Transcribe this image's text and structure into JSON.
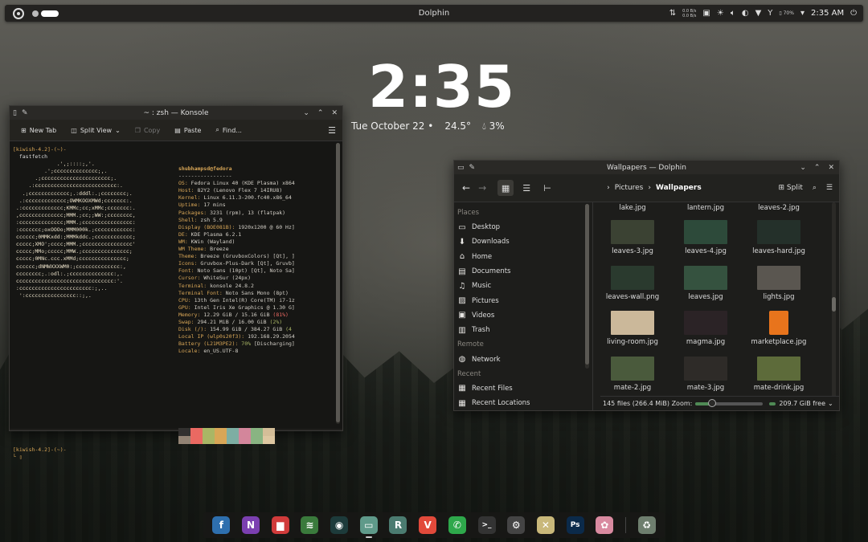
{
  "panel": {
    "title": "Dolphin",
    "net_up": "0.0 B/s",
    "net_down": "0.0 B/s",
    "battery": "70%",
    "clock": "2:35 AM"
  },
  "clock_widget": {
    "time": "2:35",
    "date": "Tue October 22 •",
    "temperature": "24.5°",
    "humidity": "3%"
  },
  "konsole": {
    "title": "~ : zsh — Konsole",
    "toolbar": {
      "new_tab": "New Tab",
      "split_view": "Split View",
      "copy": "Copy",
      "paste": "Paste",
      "find": "Find..."
    },
    "prompt1": "[kiwish-4.2]-(~)-",
    "command": "  fastfetch",
    "logo": [
      "              .',;::::;,'.",
      "          .';cccccccccccccc;,.",
      "       .;cccccccccccccccccccccc;.",
      "     .:cccccccccccccccccccccccccc:.",
      "   .;ccccccccccccc;.:dddl:.;cccccccc;.",
      "  .:ccccccccccccc;OWMKOOXMWd;ccccccc:.",
      " .:ccccccccccccc;KMMc;cc;xMMc;ccccccc:.",
      " ,cccccccccccccc;MMM.;cc;;WW:;cccccccc,",
      " :cccccccccccccc;MMM.;cccccccccccccccc:",
      " :ccccccc;oxOOOo;MMM000k.;cccccccccccc:",
      " cccccc;0MMKxdd:;MMMkddc.;cccccccccccc;",
      " ccccc;XMO';cccc;MMM.;cccccccccccccccc'",
      " ccccc;MMo;ccccc;MMW.;ccccccccccccccc;",
      " ccccc;0MNc.ccc.xMMd;ccccccccccccccc;",
      " cccccc;dNMWXXXWM0:;cccccccccccccc:,",
      " cccccccc;.:odl:.;cccccccccccccc:,.",
      " ccccccccccccccccccccccccccccccc:'.",
      " :ccccccccccccccccccccccc:;,..",
      "  ':cccccccccccccccc::;,."
    ],
    "info_header": "shubhampsd@fedora",
    "info_rule": "-----------------",
    "info": [
      {
        "k": "OS",
        "v": "Fedora Linux 40 (KDE Plasma) x864"
      },
      {
        "k": "Host",
        "v": "82Y2 (Lenovo Flex 7 14IRU8)"
      },
      {
        "k": "Kernel",
        "v": "Linux 6.11.3-200.fc40.x86_64"
      },
      {
        "k": "Uptime",
        "v": "17 mins"
      },
      {
        "k": "Packages",
        "v": "3231 (rpm), 13 (flatpak)"
      },
      {
        "k": "Shell",
        "v": "zsh 5.9"
      },
      {
        "k": "Display (BOE081B)",
        "v": "1920x1200 @ 60 Hz]"
      },
      {
        "k": "DE",
        "v": "KDE Plasma 6.2.1"
      },
      {
        "k": "WM",
        "v": "KWin (Wayland)"
      },
      {
        "k": "WM Theme",
        "v": "Breeze"
      },
      {
        "k": "Theme",
        "v": "Breeze (GruvboxColors) [Qt], ]"
      },
      {
        "k": "Icons",
        "v": "Gruvbox-Plus-Dark [Qt], Gruvb]"
      },
      {
        "k": "Font",
        "v": "Noto Sans (10pt) [Qt], Noto Sa]"
      },
      {
        "k": "Cursor",
        "v": "WhiteSur (24px)"
      },
      {
        "k": "Terminal",
        "v": "konsole 24.8.2"
      },
      {
        "k": "Terminal Font",
        "v": "Noto Sans Mono (8pt)"
      },
      {
        "k": "CPU",
        "v": "13th Gen Intel(R) Core(TM) i7-1z"
      },
      {
        "k": "GPU",
        "v": "Intel Iris Xe Graphics @ 1.30 G]"
      },
      {
        "k": "Memory",
        "v": "12.29 GiB / 15.16 GiB ",
        "extra": "(81%)",
        "extra_class": "warn"
      },
      {
        "k": "Swap",
        "v": "294.21 MiB / 16.00 GiB ",
        "extra": "(2%)",
        "extra_class": "ok"
      },
      {
        "k": "Disk (/)",
        "v": "154.99 GiB / 384.27 GiB ",
        "extra": "(4",
        "extra_class": "ok"
      },
      {
        "k": "Local IP (wlp0s20f3)",
        "v": "192.168.29.2054"
      },
      {
        "k": "Battery (L21M3PE2)",
        "v": "",
        "extra": "70%",
        "extra_class": "ok",
        "tail": " [Discharging]"
      },
      {
        "k": "Locale",
        "v": "en_US.UTF-8"
      }
    ],
    "palette": [
      "#32302f",
      "#ea6962",
      "#a9b665",
      "#d8a657",
      "#7daea3",
      "#d3869b",
      "#89b482",
      "#d4be98",
      "#928374",
      "#ea6962",
      "#a9b665",
      "#d8a657",
      "#7daea3",
      "#d3869b",
      "#89b482",
      "#ddc7a1"
    ],
    "prompt2": "[kiwish-4.2]-(~)-"
  },
  "dolphin": {
    "title": "Wallpapers — Dolphin",
    "breadcrumb_parent": "Pictures",
    "breadcrumb_current": "Wallpapers",
    "split_label": "Split",
    "places_header": "Places",
    "places": [
      {
        "label": "Desktop",
        "icon": "desktop-icon",
        "glyph": "▭"
      },
      {
        "label": "Downloads",
        "icon": "download-icon",
        "glyph": "⬇"
      },
      {
        "label": "Home",
        "icon": "home-icon",
        "glyph": "⌂"
      },
      {
        "label": "Documents",
        "icon": "document-icon",
        "glyph": "▤"
      },
      {
        "label": "Music",
        "icon": "music-icon",
        "glyph": "♫"
      },
      {
        "label": "Pictures",
        "icon": "picture-icon",
        "glyph": "▨"
      },
      {
        "label": "Videos",
        "icon": "video-icon",
        "glyph": "▣"
      },
      {
        "label": "Trash",
        "icon": "trash-icon",
        "glyph": "▥"
      }
    ],
    "remote_header": "Remote",
    "remote": [
      {
        "label": "Network",
        "icon": "network-icon",
        "glyph": "◍"
      }
    ],
    "recent_header": "Recent",
    "recent": [
      {
        "label": "Recent Files",
        "icon": "recent-files-icon",
        "glyph": "▦"
      },
      {
        "label": "Recent Locations",
        "icon": "recent-locations-icon",
        "glyph": "▦"
      }
    ],
    "files": [
      {
        "name": "lake.jpg",
        "thumb": ""
      },
      {
        "name": "lantern.jpg",
        "thumb": ""
      },
      {
        "name": "leaves-2.jpg",
        "thumb": ""
      },
      {
        "name": "leaves-3.jpg",
        "thumb": "#3b4233"
      },
      {
        "name": "leaves-4.jpg",
        "thumb": "#2d4a3a"
      },
      {
        "name": "leaves-hard.jpg",
        "thumb": "#24302a"
      },
      {
        "name": "leaves-wall.png",
        "thumb": "#2a3a2e"
      },
      {
        "name": "leaves.jpg",
        "thumb": "#35523f"
      },
      {
        "name": "lights.jpg",
        "thumb": "#5a5650"
      },
      {
        "name": "living-room.jpg",
        "thumb": "#cbb89a"
      },
      {
        "name": "magma.jpg",
        "thumb": "#2b2326"
      },
      {
        "name": "marketplace.jpg",
        "thumb": "#e8741c"
      },
      {
        "name": "mate-2.jpg",
        "thumb": "#4a5a3c"
      },
      {
        "name": "mate-3.jpg",
        "thumb": "#2e2b28"
      },
      {
        "name": "mate-drink.jpg",
        "thumb": "#5d6b3a"
      }
    ],
    "status_files": "145 files (266.4 MiB)",
    "status_zoom_label": "Zoom:",
    "zoom_level": 0.25,
    "status_free": "209.7 GiB free"
  },
  "dock": [
    {
      "name": "fedora-mediawriter-icon",
      "glyph": "f",
      "bg": "#2e6fae"
    },
    {
      "name": "onenote-icon",
      "glyph": "N",
      "bg": "#7b3fb0"
    },
    {
      "name": "audio-app-icon",
      "glyph": "▆",
      "bg": "#d13b3b"
    },
    {
      "name": "layers-icon",
      "glyph": "≋",
      "bg": "#3a7a3c"
    },
    {
      "name": "spotify-like-icon",
      "glyph": "◉",
      "bg": "#1d3b3b"
    },
    {
      "name": "dolphin-icon",
      "glyph": "▭",
      "bg": "#5f9a8a",
      "active": true
    },
    {
      "name": "r-app-icon",
      "glyph": "R",
      "bg": "#4b7b70"
    },
    {
      "name": "vivaldi-icon",
      "glyph": "V",
      "bg": "#e24a3b"
    },
    {
      "name": "whatsapp-icon",
      "glyph": "✆",
      "bg": "#2ea84b"
    },
    {
      "name": "konsole-icon",
      "glyph": ">_",
      "bg": "#333"
    },
    {
      "name": "settings-icon",
      "glyph": "⚙",
      "bg": "#444"
    },
    {
      "name": "tools-icon",
      "glyph": "✕",
      "bg": "#c9b87a"
    },
    {
      "name": "photoshop-icon",
      "glyph": "Ps",
      "bg": "#0b2a4a"
    },
    {
      "name": "anime-app-icon",
      "glyph": "✿",
      "bg": "#d98aa0"
    },
    {
      "name": "trash-dock-icon",
      "glyph": "♻",
      "bg": "#6e7e6e"
    }
  ]
}
